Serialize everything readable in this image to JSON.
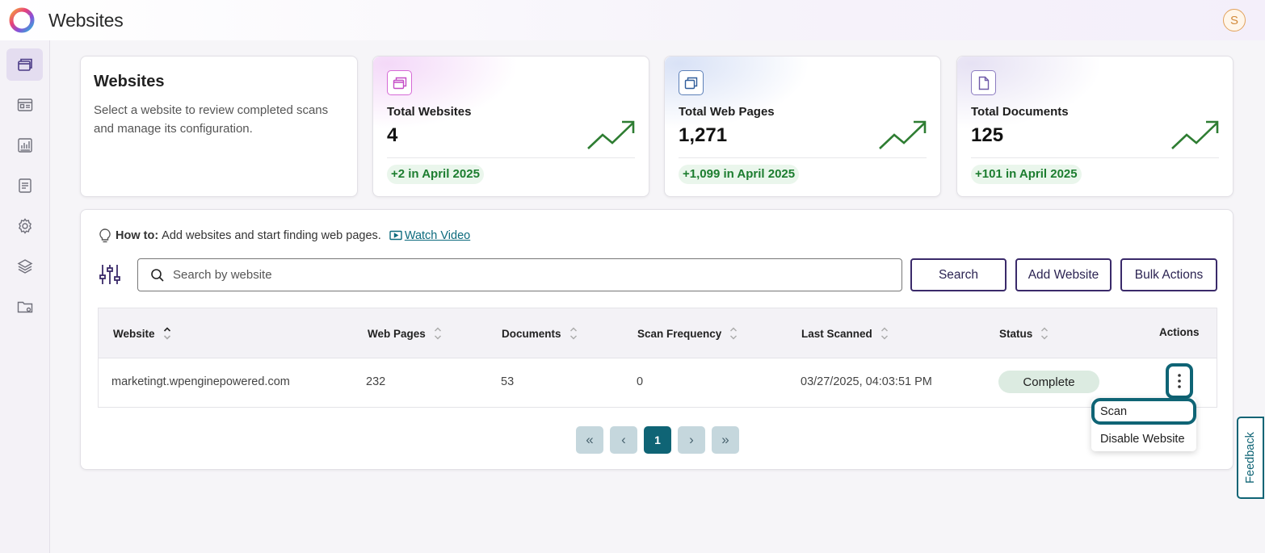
{
  "app": {
    "title": "Websites",
    "avatar_initial": "S"
  },
  "sidebar": {
    "items": [
      {
        "icon": "websites-icon",
        "active": true
      },
      {
        "icon": "dashboard-icon",
        "active": false
      },
      {
        "icon": "reports-icon",
        "active": false
      },
      {
        "icon": "document-icon",
        "active": false
      },
      {
        "icon": "gear-icon",
        "active": false
      },
      {
        "icon": "layers-icon",
        "active": false
      },
      {
        "icon": "folder-settings-icon",
        "active": false
      }
    ]
  },
  "intro": {
    "title": "Websites",
    "description": "Select a website to review completed scans and manage its configuration."
  },
  "stats": [
    {
      "label": "Total Websites",
      "value": "4",
      "delta": "+2 in April 2025",
      "icon": "websites-icon",
      "accent": "#c44bc6"
    },
    {
      "label": "Total Web Pages",
      "value": "1,271",
      "delta": "+1,099 in April 2025",
      "icon": "web-pages-icon",
      "accent": "#2f5c9a"
    },
    {
      "label": "Total Documents",
      "value": "125",
      "delta": "+101 in April 2025",
      "icon": "document-icon",
      "accent": "#6f5aa8"
    }
  ],
  "howto": {
    "prefix": "How to:",
    "text": "Add websites and start finding web pages.",
    "link": "Watch Video"
  },
  "search": {
    "placeholder": "Search by website",
    "value": ""
  },
  "buttons": {
    "search": "Search",
    "add_website": "Add Website",
    "bulk_actions": "Bulk Actions"
  },
  "table": {
    "columns": [
      "Website",
      "Web Pages",
      "Documents",
      "Scan Frequency",
      "Last Scanned",
      "Status",
      "Actions"
    ],
    "rows": [
      {
        "website": "marketingt.wpenginepowered.com",
        "web_pages": "232",
        "documents": "53",
        "scan_frequency": "0",
        "last_scanned": "03/27/2025, 04:03:51 PM",
        "status": "Complete"
      }
    ]
  },
  "pagination": {
    "first": "«",
    "prev": "‹",
    "current": "1",
    "next": "›",
    "last": "»"
  },
  "actions_menu": {
    "items": [
      "Scan",
      "Disable Website"
    ]
  },
  "feedback": {
    "label": "Feedback"
  },
  "colors": {
    "primary": "#0f6475",
    "button_border": "#3a2a6a",
    "positive": "#1c7d2f",
    "trend": "#2e7d32"
  }
}
